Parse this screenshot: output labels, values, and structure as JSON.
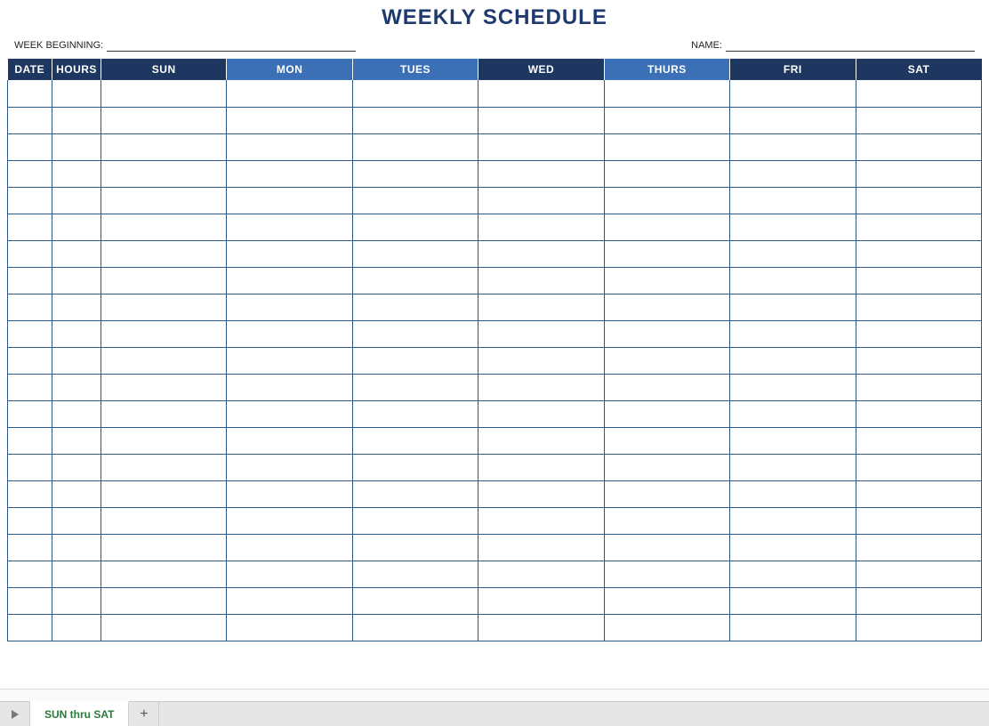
{
  "title": "WEEKLY SCHEDULE",
  "labels": {
    "week_beginning": "WEEK BEGINNING:",
    "name": "NAME:"
  },
  "fields": {
    "week_beginning_value": "",
    "name_value": ""
  },
  "columns": [
    {
      "label": "DATE",
      "style": "dark",
      "cls": "col-date"
    },
    {
      "label": "HOURS",
      "style": "dark",
      "cls": "col-hours"
    },
    {
      "label": "SUN",
      "style": "dark",
      "cls": "col-day"
    },
    {
      "label": "MON",
      "style": "light",
      "cls": "col-day"
    },
    {
      "label": "TUES",
      "style": "light",
      "cls": "col-day"
    },
    {
      "label": "WED",
      "style": "dark",
      "cls": "col-day"
    },
    {
      "label": "THURS",
      "style": "light",
      "cls": "col-day"
    },
    {
      "label": "FRI",
      "style": "dark",
      "cls": "col-day"
    },
    {
      "label": "SAT",
      "style": "dark",
      "cls": "col-day"
    }
  ],
  "row_count": 21,
  "tabs": {
    "active": "SUN thru SAT"
  }
}
